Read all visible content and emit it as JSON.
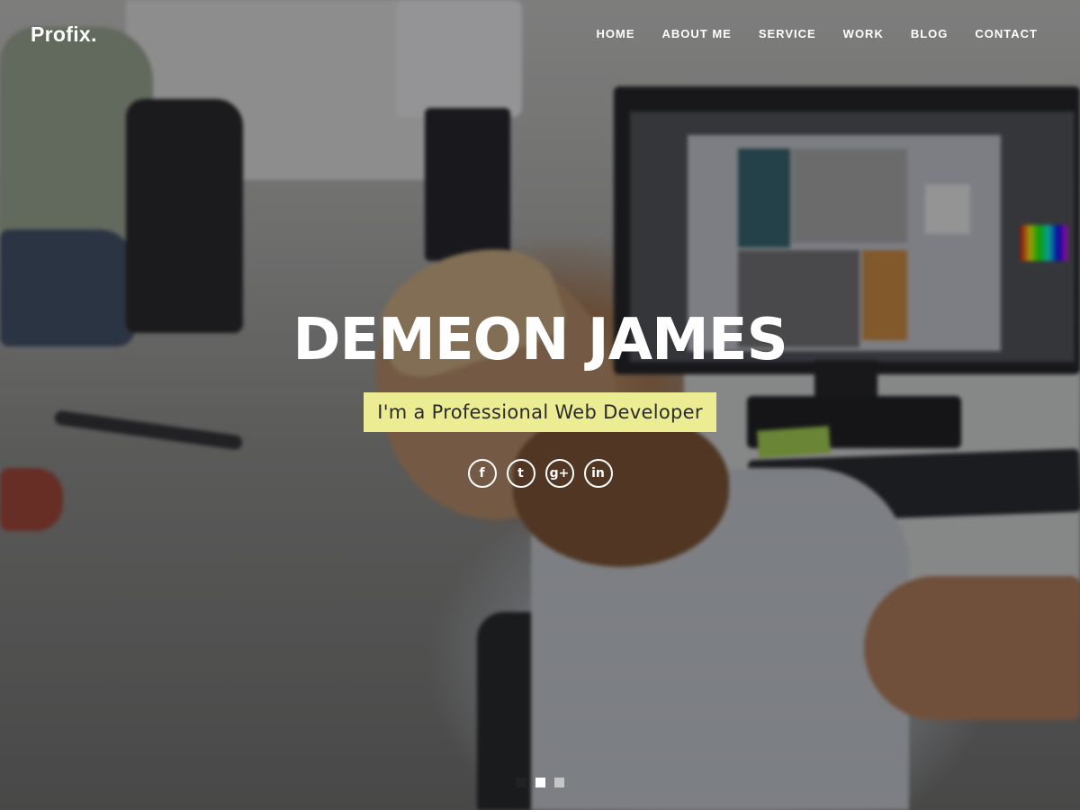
{
  "header": {
    "logo": "Profix.",
    "nav": [
      {
        "label": "HOME"
      },
      {
        "label": "ABOUT ME"
      },
      {
        "label": "SERVICE"
      },
      {
        "label": "WORK"
      },
      {
        "label": "BLOG"
      },
      {
        "label": "CONTACT"
      }
    ]
  },
  "hero": {
    "title": "DEMEON JAMES",
    "tagline": "I'm a Professional Web Developer",
    "social": [
      {
        "icon": "facebook-icon",
        "glyph": "f"
      },
      {
        "icon": "twitter-icon",
        "glyph": "t"
      },
      {
        "icon": "google-plus-icon",
        "glyph": "g+"
      },
      {
        "icon": "linkedin-icon",
        "glyph": "in"
      }
    ],
    "slider": {
      "count": 3,
      "active_index": 1
    }
  },
  "colors": {
    "tagline_bg": "#ecec93",
    "text": "#ffffff",
    "overlay": "rgba(22,22,24,0.42)"
  }
}
